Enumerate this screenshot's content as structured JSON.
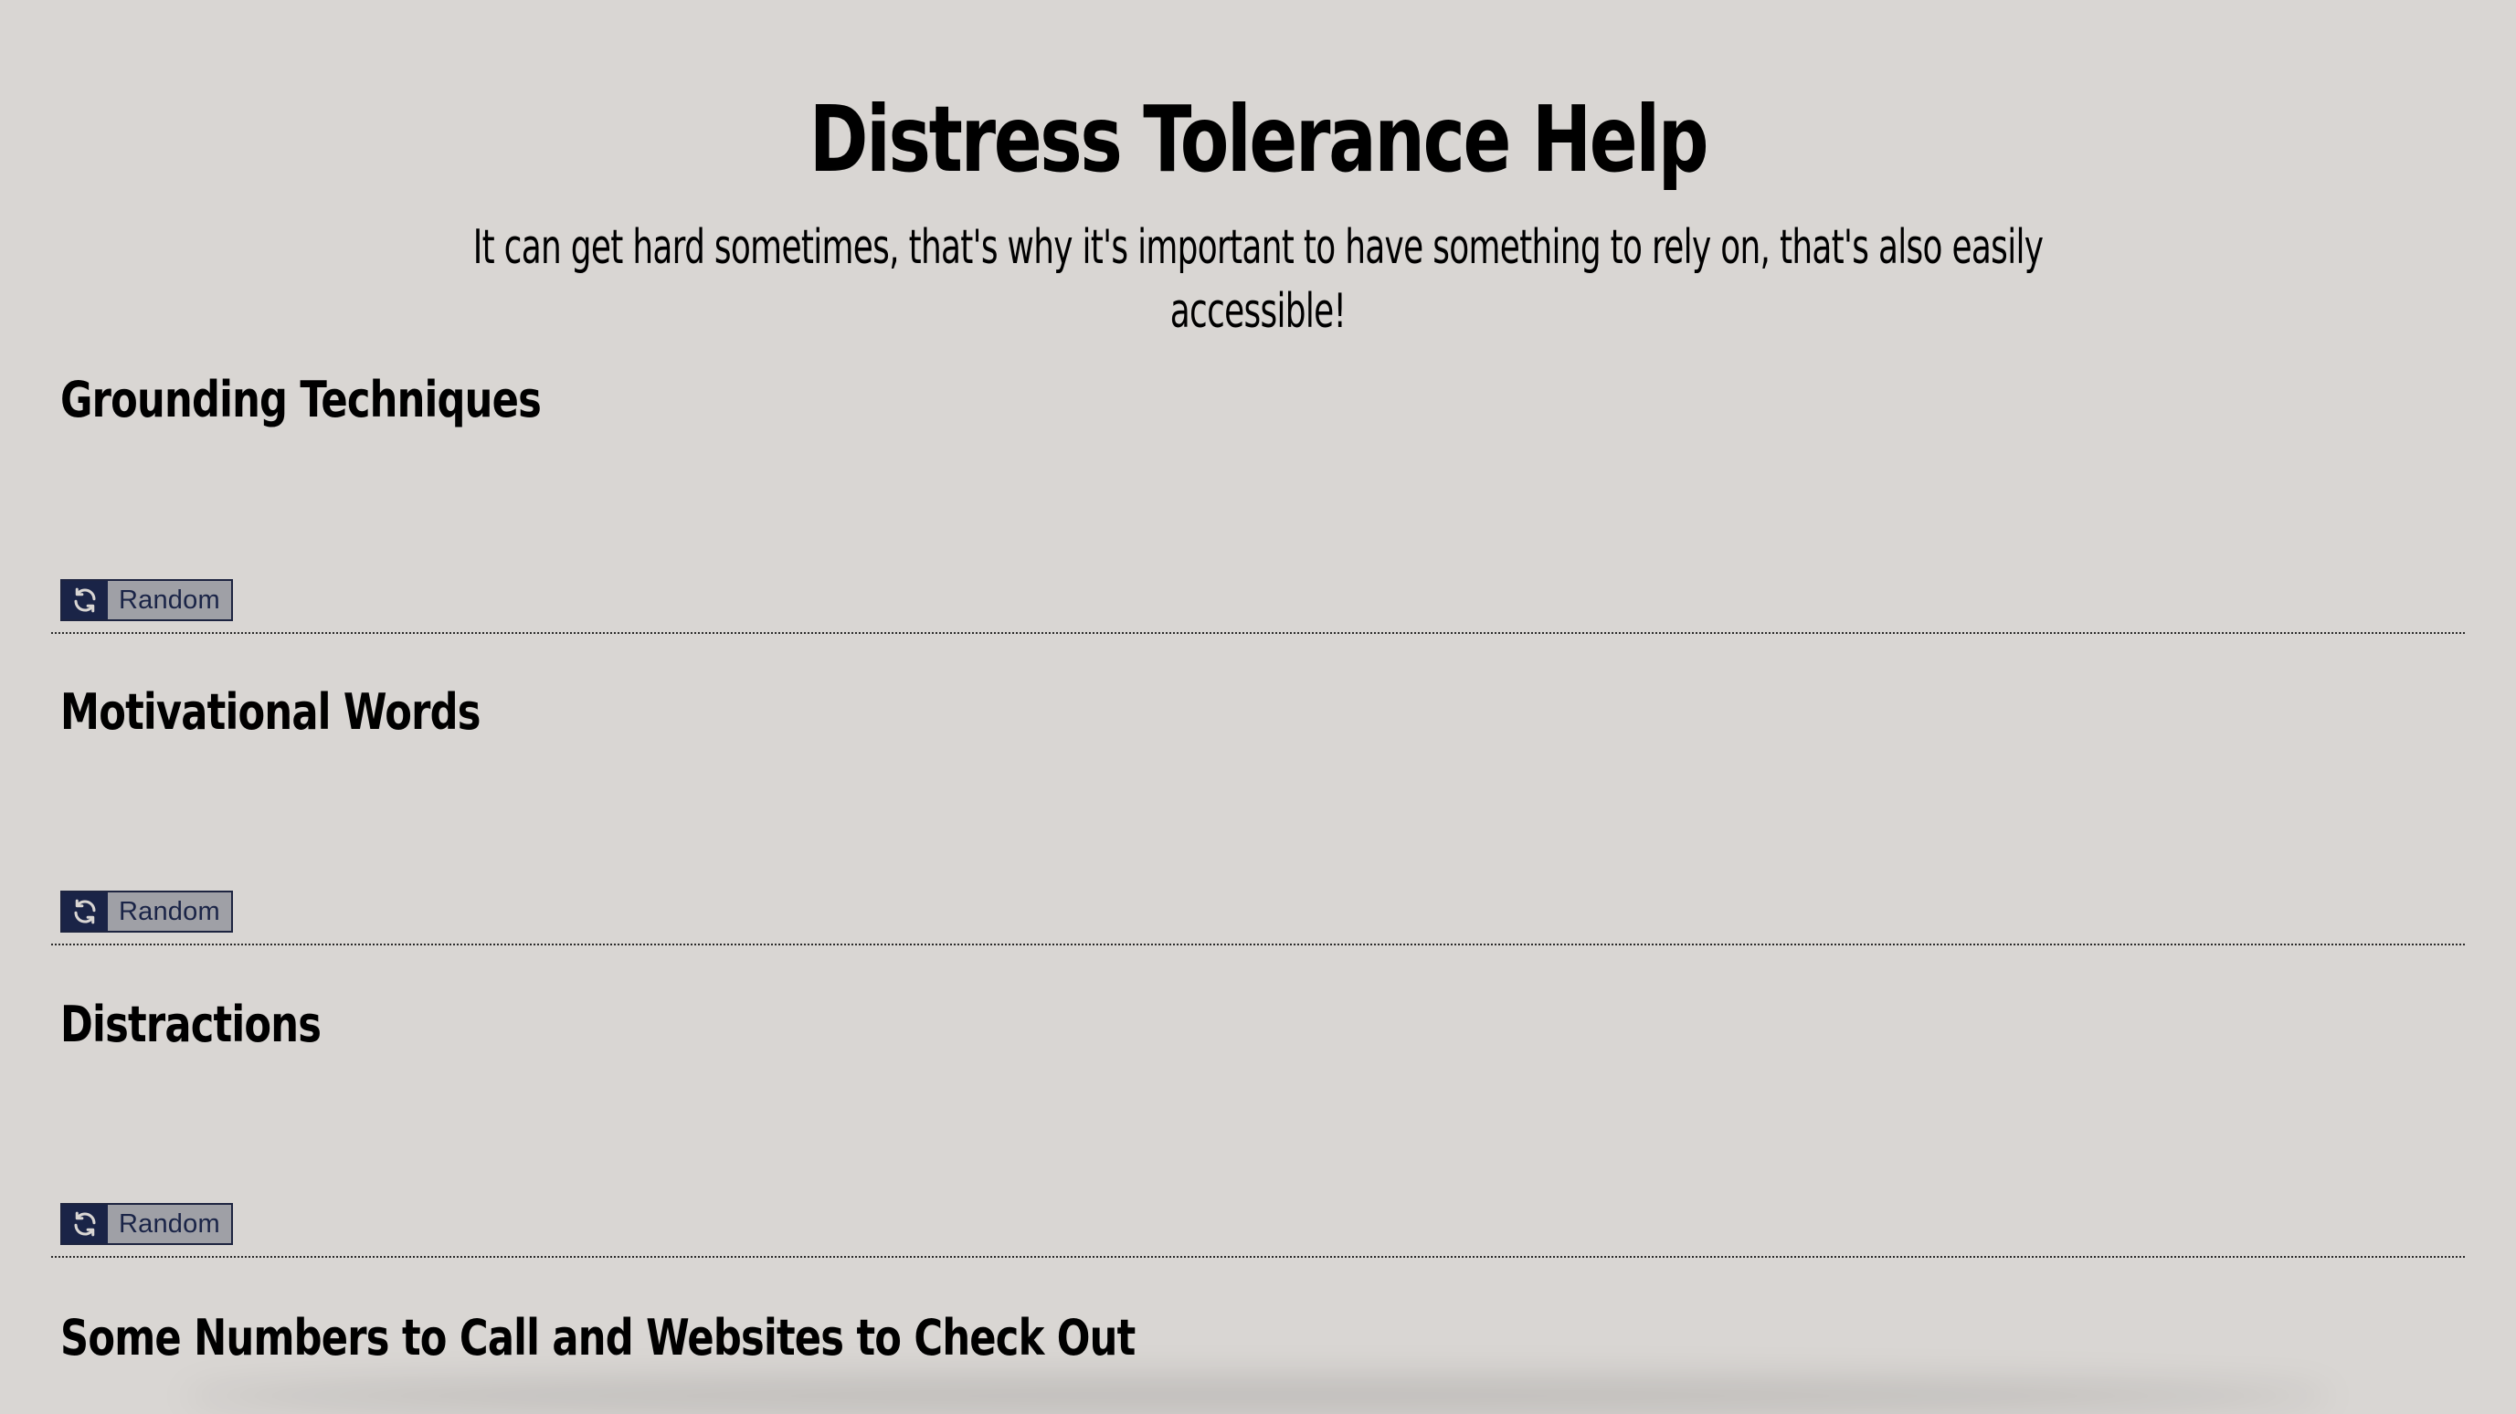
{
  "header": {
    "title": "Distress Tolerance Help",
    "subtitle": "It can get hard sometimes, that's why it's important to have something to rely on, that's also easily accessible!"
  },
  "sections": [
    {
      "heading": "Grounding Techniques",
      "button_label": "Random",
      "button_icon": "refresh-icon"
    },
    {
      "heading": "Motivational Words",
      "button_label": "Random",
      "button_icon": "refresh-icon"
    },
    {
      "heading": "Distractions",
      "button_label": "Random",
      "button_icon": "refresh-icon"
    },
    {
      "heading": "Some Numbers to Call and Websites to Check Out"
    }
  ],
  "colors": {
    "background": "#d9d6d3",
    "button_icon_bg": "#1a2447",
    "button_label_bg": "#9fa0a6",
    "button_text": "#1a2447"
  }
}
